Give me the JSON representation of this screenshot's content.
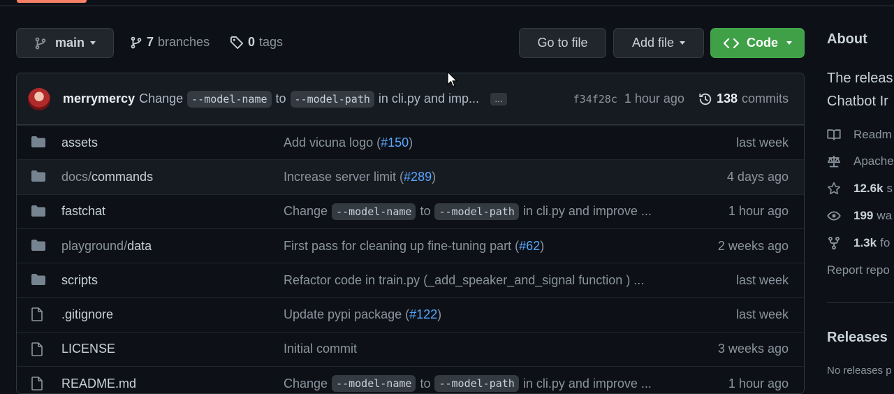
{
  "toolbar": {
    "branch_label": "main",
    "branches_count": "7",
    "branches_label": "branches",
    "tags_count": "0",
    "tags_label": "tags",
    "go_to_file_label": "Go to file",
    "add_file_label": "Add file",
    "code_label": "Code"
  },
  "commit": {
    "author": "merrymercy",
    "message_pre": "Change",
    "token1": "--model-name",
    "message_mid": "to",
    "token2": "--model-path",
    "message_post": "in cli.py and imp...",
    "ellipsis": "…",
    "sha": "f34f28c",
    "time": "1 hour ago",
    "commits_count": "138",
    "commits_label": "commits"
  },
  "files": [
    {
      "name_dim": "",
      "name": "assets",
      "type": "folder",
      "msg": "Add vicuna logo (",
      "pr": "#150",
      "msg_end": ")",
      "when": "last week"
    },
    {
      "name_dim": "docs/",
      "name": "commands",
      "type": "folder",
      "msg": "Increase server limit (",
      "pr": "#289",
      "msg_end": ")",
      "when": "4 days ago"
    },
    {
      "name_dim": "",
      "name": "fastchat",
      "type": "folder",
      "msg_pre": "Change",
      "tok1": "--model-name",
      "msg_mid": "to",
      "tok2": "--model-path",
      "msg_post": "in cli.py and improve ...",
      "when": "1 hour ago"
    },
    {
      "name_dim": "playground/",
      "name": "data",
      "type": "folder",
      "msg": "First pass for cleaning up fine-tuning part (",
      "pr": "#62",
      "msg_end": ")",
      "when": "2 weeks ago"
    },
    {
      "name_dim": "",
      "name": "scripts",
      "type": "folder",
      "msg": "Refactor code in train.py (_add_speaker_and_signal function ) ...",
      "when": "last week"
    },
    {
      "name_dim": "",
      "name": ".gitignore",
      "type": "file",
      "msg": "Update pypi package (",
      "pr": "#122",
      "msg_end": ")",
      "when": "last week"
    },
    {
      "name_dim": "",
      "name": "LICENSE",
      "type": "file",
      "msg": "Initial commit",
      "when": "3 weeks ago"
    },
    {
      "name_dim": "",
      "name": "README.md",
      "type": "file",
      "msg_pre": "Change",
      "tok1": "--model-name",
      "msg_mid": "to",
      "tok2": "--model-path",
      "msg_post": "in cli.py and improve ...",
      "when": "1 hour ago"
    }
  ],
  "about": {
    "title": "About",
    "desc_line1": "The releas",
    "desc_line2": "Chatbot Ir",
    "readme": "Readm",
    "license": "Apache",
    "stars_count": "12.6k",
    "stars_label": "s",
    "watchers_count": "199",
    "watchers_label": "wa",
    "forks_count": "1.3k",
    "forks_label": "fo",
    "report": "Report repo",
    "releases_title": "Releases",
    "no_releases": "No releases p"
  }
}
